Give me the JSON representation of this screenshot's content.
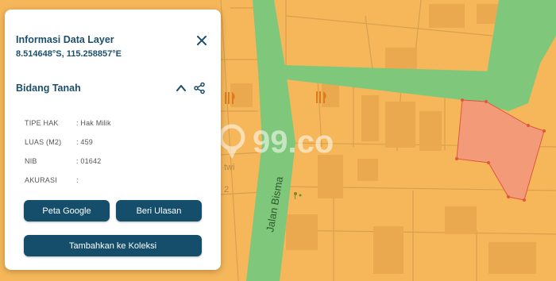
{
  "panel": {
    "title": "Informasi Data Layer",
    "coordinates": "8.514648°S, 115.258857°E",
    "section_title": "Bidang Tanah"
  },
  "attributes": [
    {
      "key": "TIPE HAK",
      "value": ": Hak Milik"
    },
    {
      "key": "LUAS (M2)",
      "value": ": 459"
    },
    {
      "key": "NIB",
      "value": ": 01642"
    },
    {
      "key": "AKURASI",
      "value": ":"
    }
  ],
  "buttons": {
    "google": "Peta Google",
    "review": "Beri Ulasan",
    "collection": "Tambahkan ke Koleksi"
  },
  "map": {
    "road_label": "Jalan Bisma",
    "watermark": "99.co",
    "partial_label": "twi",
    "partial_label_2": "2",
    "colors": {
      "land": "#f5b75a",
      "green_zone": "#7ec77b",
      "selected_parcel": "#f39a78",
      "border": "#d99a48"
    }
  }
}
